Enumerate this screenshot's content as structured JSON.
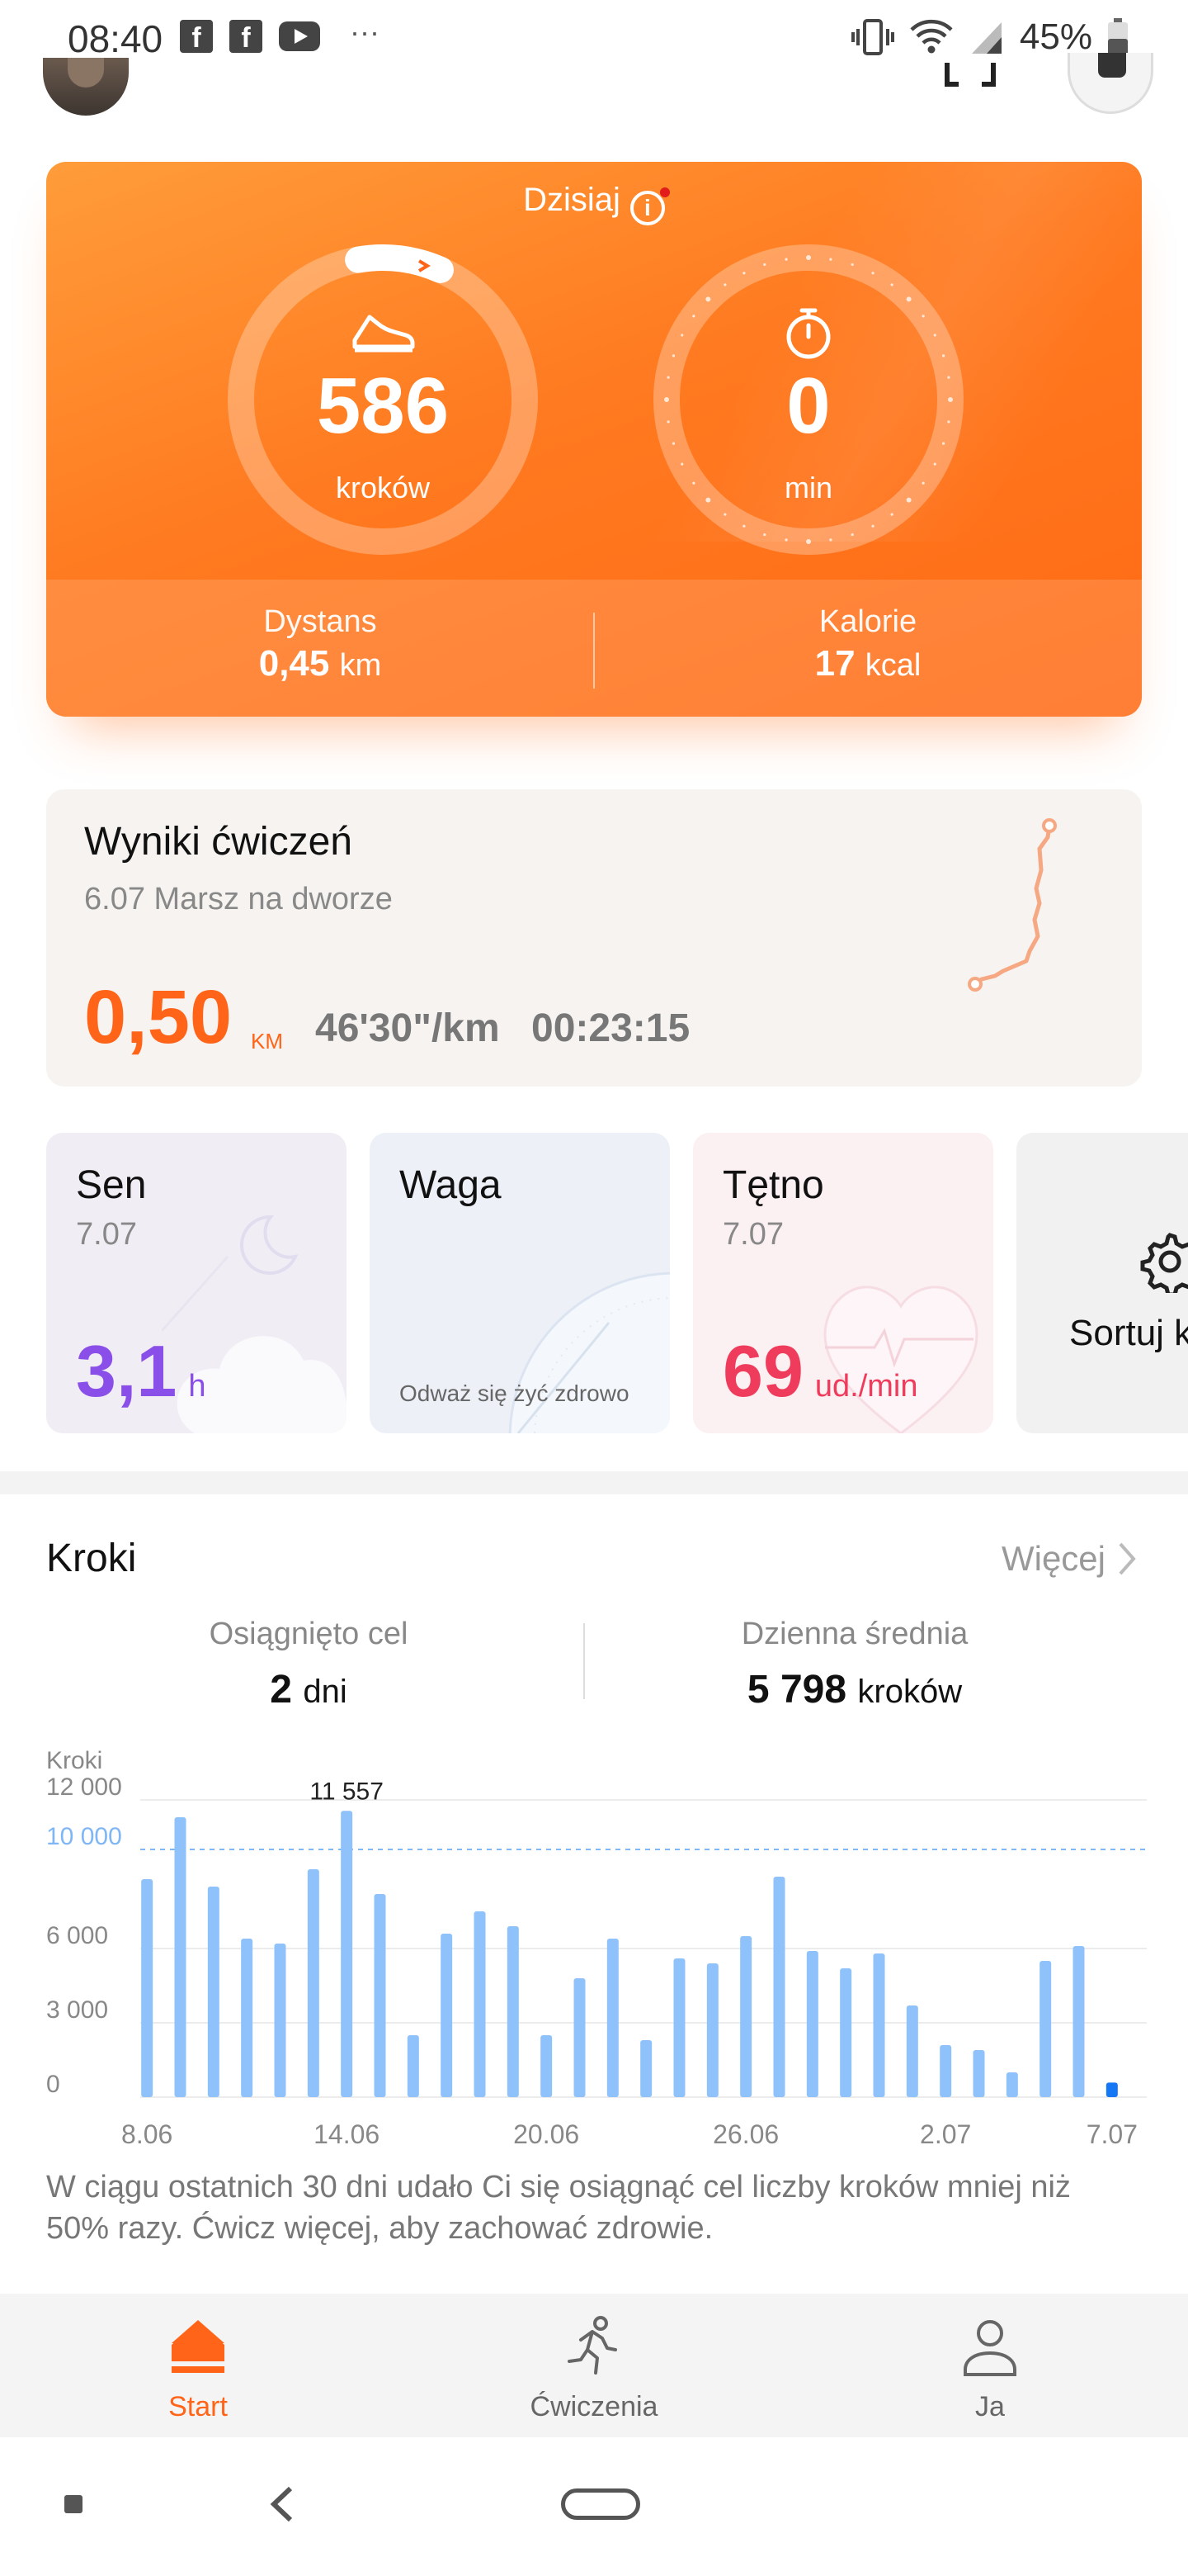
{
  "status_bar": {
    "time": "08:40",
    "notification_icons": [
      "facebook-icon",
      "facebook-icon",
      "youtube-icon"
    ],
    "overflow": "···",
    "battery": "45%"
  },
  "today": {
    "label": "Dzisiaj",
    "steps": {
      "value": "586",
      "unit": "kroków"
    },
    "active_time": {
      "value": "0",
      "unit": "min"
    },
    "distance": {
      "label": "Dystans",
      "value": "0,45",
      "unit": "km"
    },
    "calories": {
      "label": "Kalorie",
      "value": "17",
      "unit": "kcal"
    }
  },
  "workout": {
    "title": "Wyniki ćwiczeń",
    "subtitle": "6.07  Marsz na dworze",
    "distance": "0,50",
    "distance_unit": "KM",
    "pace": "46'30\"/km",
    "duration": "00:23:15"
  },
  "cards": {
    "sleep": {
      "title": "Sen",
      "date": "7.07",
      "value": "3,1",
      "unit": "h"
    },
    "weight": {
      "title": "Waga",
      "motto": "Odważ się żyć zdrowo"
    },
    "heart": {
      "title": "Tętno",
      "date": "7.07",
      "value": "69",
      "unit": "ud./min"
    },
    "sort": {
      "label": "Sortuj k"
    }
  },
  "steps_section": {
    "title": "Kroki",
    "more": "Więcej",
    "goal_label": "Osiągnięto cel",
    "goal_value": "2",
    "goal_unit": "dni",
    "avg_label": "Dzienna średnia",
    "avg_value": "5 798",
    "avg_unit": "kroków",
    "note": "W ciągu ostatnich 30 dni udało Ci się osiągnąć cel liczby kroków mniej niż 50% razy. Ćwicz więcej, aby zachować zdrowie."
  },
  "chart_data": {
    "type": "bar",
    "ylabel": "Kroki",
    "y_ticks": [
      "12 000",
      "6 000",
      "3 000",
      "0"
    ],
    "goal_line": {
      "value": 10000,
      "label": "10 000"
    },
    "max_label": "11 557",
    "ylim": [
      0,
      12000
    ],
    "x_tick_labels": [
      "8.06",
      "14.06",
      "20.06",
      "26.06",
      "2.07",
      "7.07"
    ],
    "categories": [
      "8.06",
      "9.06",
      "10.06",
      "11.06",
      "12.06",
      "13.06",
      "14.06",
      "15.06",
      "16.06",
      "17.06",
      "18.06",
      "19.06",
      "20.06",
      "21.06",
      "22.06",
      "23.06",
      "24.06",
      "25.06",
      "26.06",
      "27.06",
      "28.06",
      "29.06",
      "30.06",
      "1.07",
      "2.07",
      "3.07",
      "4.07",
      "5.07",
      "6.07",
      "7.07"
    ],
    "values": [
      8800,
      11300,
      8500,
      6400,
      6200,
      9200,
      11557,
      8200,
      2500,
      6600,
      7500,
      6900,
      2500,
      4800,
      6400,
      2300,
      5600,
      5400,
      6500,
      8900,
      5900,
      5200,
      5800,
      3700,
      2100,
      1900,
      1000,
      5500,
      6100,
      586
    ],
    "colors": {
      "bar": "#8fc2fb",
      "today_bar": "#1677f5",
      "goal_line": "#7fb6f5"
    }
  },
  "bottom_nav": {
    "items": [
      {
        "label": "Start",
        "icon": "home-icon",
        "active": true
      },
      {
        "label": "Ćwiczenia",
        "icon": "running-icon",
        "active": false
      },
      {
        "label": "Ja",
        "icon": "person-icon",
        "active": false
      }
    ]
  },
  "colors": {
    "accent": "#ff6418",
    "sleep": "#8a4fe8",
    "heart": "#f03c5c"
  }
}
